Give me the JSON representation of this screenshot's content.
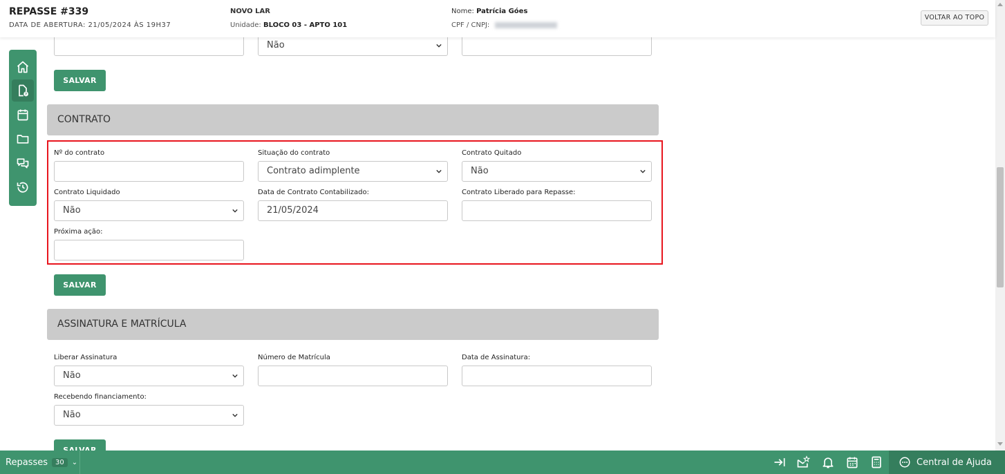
{
  "header": {
    "title": "REPASSE #339",
    "opened": "DATA DE ABERTURA: 21/05/2024 ÀS 19H37",
    "project": "NOVO LAR",
    "unit_label": "Unidade:",
    "unit_value": "BLOCO 03 - APTO 101",
    "name_label": "Nome:",
    "name_value": "Patrícia Góes",
    "cpf_label": "CPF / CNPJ:",
    "back_to_top": "VOLTAR AO TOPO"
  },
  "sidebar": {
    "items": [
      {
        "icon": "home-icon"
      },
      {
        "icon": "document-badge-icon",
        "active": true
      },
      {
        "icon": "calendar-icon"
      },
      {
        "icon": "folder-icon"
      },
      {
        "icon": "chat-icon"
      },
      {
        "icon": "history-icon"
      }
    ]
  },
  "top_partial": {
    "select_value": "Não",
    "save_label": "SALVAR"
  },
  "contrato": {
    "title": "CONTRATO",
    "fields": {
      "numero_label": "Nº do contrato",
      "numero_value": "",
      "situacao_label": "Situação do contrato",
      "situacao_value": "Contrato adimplente",
      "quitado_label": "Contrato Quitado",
      "quitado_value": "Não",
      "liquidado_label": "Contrato Liquidado",
      "liquidado_value": "Não",
      "contabilizado_label": "Data de Contrato Contabilizado:",
      "contabilizado_value": "21/05/2024",
      "liberado_label": "Contrato Liberado para Repasse:",
      "liberado_value": "",
      "proxima_label": "Próxima ação:",
      "proxima_value": ""
    },
    "save_label": "SALVAR"
  },
  "assinatura": {
    "title": "ASSINATURA E MATRÍCULA",
    "fields": {
      "liberar_label": "Liberar Assinatura",
      "liberar_value": "Não",
      "matricula_label": "Número de Matrícula",
      "matricula_value": "",
      "data_label": "Data de Assinatura:",
      "data_value": "",
      "financiamento_label": "Recebendo financiamento:",
      "financiamento_value": "Não"
    },
    "save_label": "SALVAR"
  },
  "footer": {
    "module": "Repasses",
    "count": "30",
    "help": "Central de Ajuda",
    "icons": [
      "collapse-right-icon",
      "mail-star-icon",
      "bell-icon",
      "calendar-icon",
      "calculator-icon"
    ]
  },
  "colors": {
    "primary": "#3f946e",
    "primary_dark": "#357e5d",
    "section_bg": "#cbcbcb",
    "highlight": "#e8141d"
  }
}
